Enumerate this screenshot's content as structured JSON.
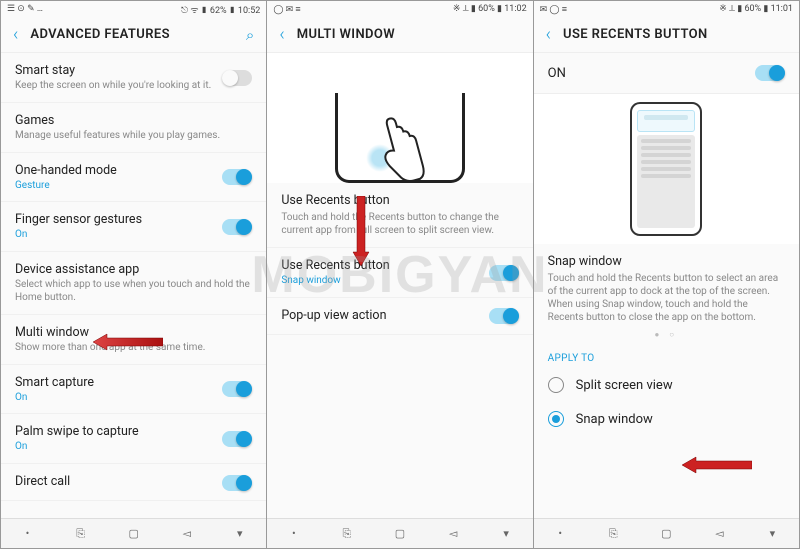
{
  "watermark": "MOBIGYAN",
  "panel1": {
    "status": {
      "left_icons": "☰ ⊙ ✎ …",
      "right": "⎋ ᯤ ▮ 62% ▮ 10:52"
    },
    "title": "ADVANCED FEATURES",
    "rows": [
      {
        "title": "Smart stay",
        "sub": "Keep the screen on while you're looking at it.",
        "toggle": "off"
      },
      {
        "title": "Games",
        "sub": "Manage useful features while you play games."
      },
      {
        "title": "One-handed mode",
        "sub": "Gesture",
        "sub_on": true,
        "toggle": "on"
      },
      {
        "title": "Finger sensor gestures",
        "sub": "On",
        "sub_on": true,
        "toggle": "on"
      },
      {
        "title": "Device assistance app",
        "sub": "Select which app to use when you touch and hold the Home button."
      },
      {
        "title": "Multi window",
        "sub": "Show more than one app at the same time."
      },
      {
        "title": "Smart capture",
        "sub": "On",
        "sub_on": true,
        "toggle": "on"
      },
      {
        "title": "Palm swipe to capture",
        "sub": "On",
        "sub_on": true,
        "toggle": "on"
      },
      {
        "title": "Direct call",
        "sub": "",
        "toggle": "on"
      }
    ]
  },
  "panel2": {
    "status": {
      "left_icons": "◯ ✉ ≡",
      "right": "※ ⟂ ▮ 60% ▮ 11:02"
    },
    "title": "MULTI WINDOW",
    "desc_title": "Use Recents button",
    "desc_body": "Touch and hold the Recents button to change the current app from full screen to split screen view.",
    "rows": [
      {
        "title": "Use Recents button",
        "sub": "Snap window",
        "sub_on": true,
        "toggle": "on"
      },
      {
        "title": "Pop-up view action",
        "toggle": "on"
      }
    ]
  },
  "panel3": {
    "status": {
      "left_icons": "✉ ◯ ≡",
      "right": "※ ⟂ ▮ 60% ▮ 11:01"
    },
    "title": "USE RECENTS BUTTON",
    "on_label": "ON",
    "desc_title": "Snap window",
    "desc_body": "Touch and hold the Recents button to select an area of the current app to dock at the top of the screen.\nWhen using Snap window, touch and hold the Recents button to close the app on the bottom.",
    "apply_to": "APPLY TO",
    "options": [
      {
        "label": "Split screen view",
        "selected": false
      },
      {
        "label": "Snap window",
        "selected": true
      }
    ]
  },
  "nav": {
    "dot": "•",
    "recents": "⎘",
    "home": "▢",
    "back": "◅",
    "down": "▾"
  }
}
